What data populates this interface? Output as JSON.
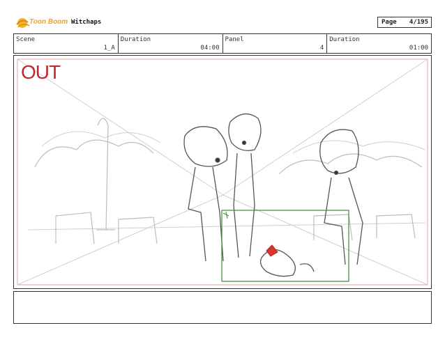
{
  "header": {
    "brand": "Toon Boom",
    "project": "Witchaps",
    "page_label": "Page",
    "page_value": "4/195"
  },
  "info": {
    "scene_label": "Scene",
    "scene_value": "1_A",
    "duration_label": "Duration",
    "duration_value": "04:00",
    "panel_label": "Panel",
    "panel_value": "4",
    "panel_duration_label": "Duration",
    "panel_duration_value": "01:00"
  },
  "frame": {
    "transition": "OUT",
    "transition_color": "#c0282d",
    "camera_box_color": "#3b8a3b",
    "accent_color": "#d9362c"
  },
  "icons": [
    "toon-boom-logo-icon"
  ]
}
